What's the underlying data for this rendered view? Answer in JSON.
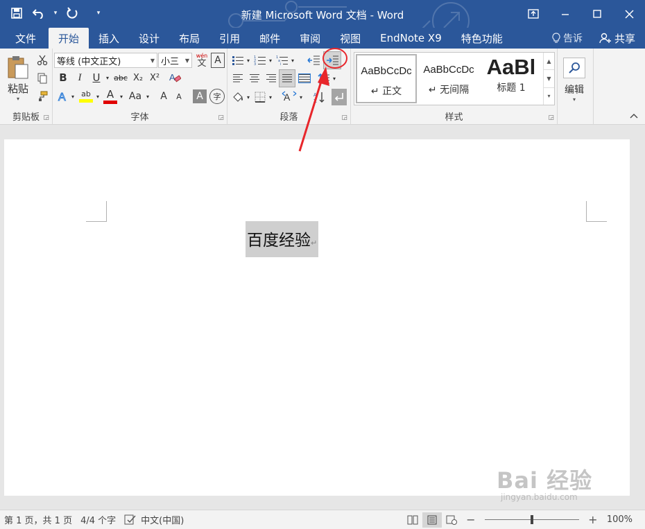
{
  "titlebar": {
    "title": "新建 Microsoft Word 文档 - Word",
    "save_icon": "save-icon",
    "undo_icon": "undo-icon",
    "redo_icon": "redo-icon"
  },
  "tabs": {
    "file": "文件",
    "home": "开始",
    "insert": "插入",
    "design": "设计",
    "layout": "布局",
    "references": "引用",
    "mailings": "邮件",
    "review": "审阅",
    "view": "视图",
    "endnote": "EndNote X9",
    "special": "特色功能",
    "tell_me": "告诉",
    "share": "共享"
  },
  "ribbon": {
    "clipboard": {
      "label": "剪贴板",
      "paste": "粘贴"
    },
    "font": {
      "label": "字体",
      "font_name": "等线 (中文正文)",
      "font_size": "小三",
      "bold": "B",
      "italic": "I",
      "underline": "U",
      "strike": "abc",
      "subscript": "X₂",
      "superscript": "X²",
      "font_color_letter": "A",
      "change_case": "Aa",
      "grow": "A",
      "shrink": "A",
      "char_border": "A",
      "phonetic": "wén",
      "phonetic_char": "文",
      "enclose": "字",
      "highlight": "ab"
    },
    "paragraph": {
      "label": "段落"
    },
    "styles": {
      "label": "样式",
      "items": [
        {
          "sample": "AaBbCcDc",
          "name": "↵ 正文"
        },
        {
          "sample": "AaBbCcDc",
          "name": "↵ 无间隔"
        },
        {
          "sample": "AaBl",
          "name": "标题 1"
        }
      ]
    },
    "editing": {
      "label": "编辑"
    }
  },
  "document": {
    "text": "百度经验",
    "pilcrow": "↵"
  },
  "watermark": {
    "logo": "Bai 经验",
    "url": "jingyan.baidu.com"
  },
  "statusbar": {
    "page": "第 1 页，共 1 页",
    "words": "4/4 个字",
    "language": "中文(中国)",
    "zoom": "100%",
    "zoom_fraction": 0.5
  },
  "colors": {
    "title_bg": "#2b579a",
    "ribbon_bg": "#f3f3f3",
    "annotation": "#e8262b",
    "highlight_yellow": "#ffff00",
    "font_red": "#e00000"
  }
}
